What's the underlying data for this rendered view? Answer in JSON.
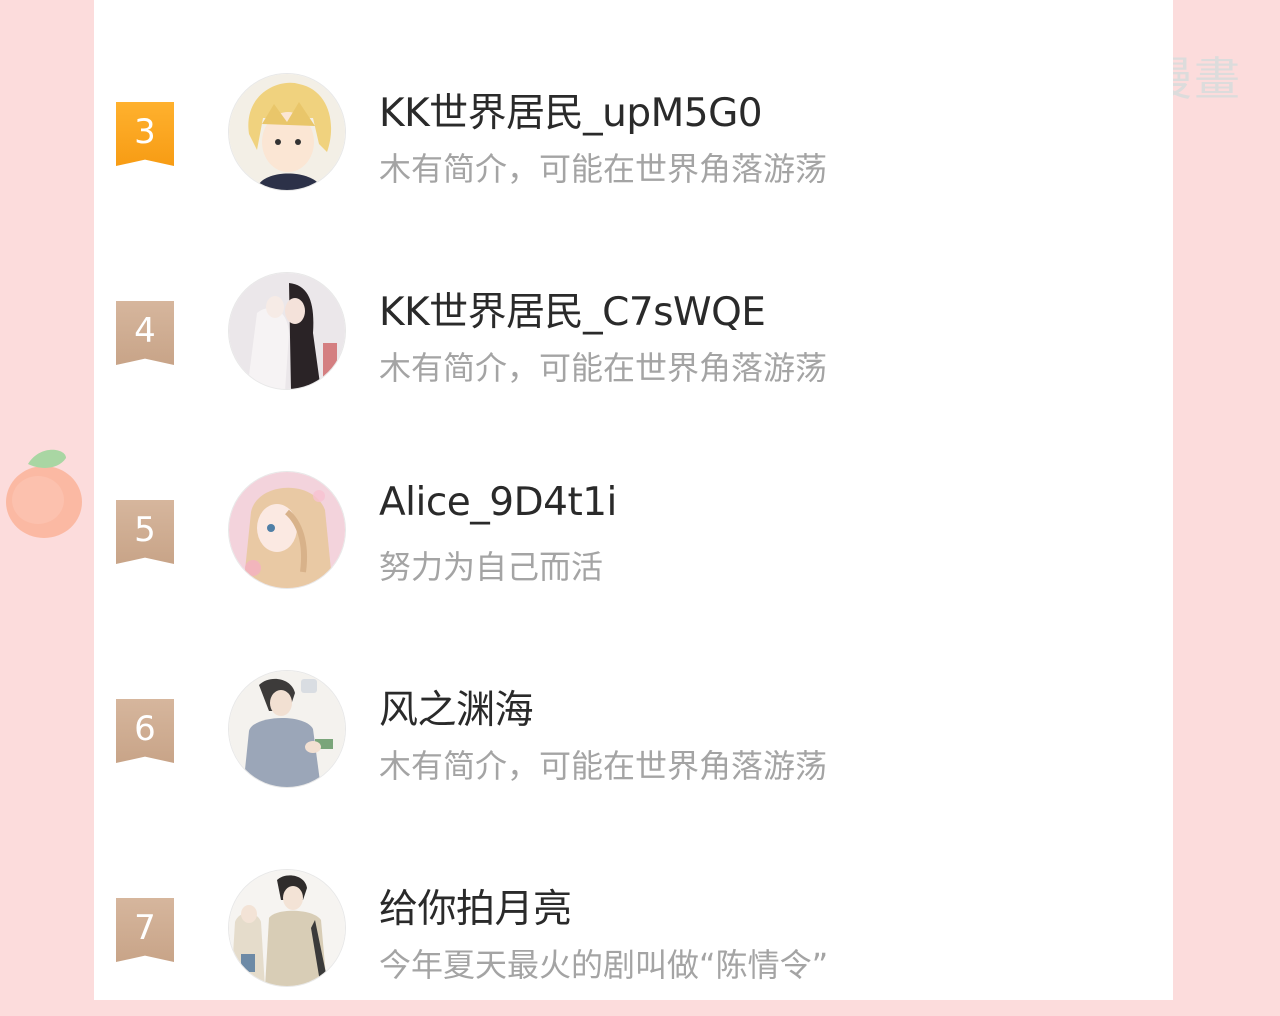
{
  "watermark": {
    "text": "包子漫畫",
    "logo_icon": "bun-logo-icon"
  },
  "colors": {
    "page_background": "#fcdcdc",
    "rank_top": "#f7a41e",
    "rank_normal": "#cdab90",
    "name_text": "#2a2a2a",
    "bio_text": "#a4a4a4"
  },
  "rankings": [
    {
      "rank": "3",
      "name": "KK世界居民_upM5G0",
      "bio": "木有简介，可能在世界角落游荡"
    },
    {
      "rank": "4",
      "name": "KK世界居民_C7sWQE",
      "bio": "木有简介，可能在世界角落游荡"
    },
    {
      "rank": "5",
      "name": "Alice_9D4t1i",
      "bio": "努力为自己而活"
    },
    {
      "rank": "6",
      "name": "风之渊海",
      "bio": "木有简介，可能在世界角落游荡"
    },
    {
      "rank": "7",
      "name": "给你拍月亮",
      "bio": "今年夏天最火的剧叫做“陈情令”"
    }
  ]
}
